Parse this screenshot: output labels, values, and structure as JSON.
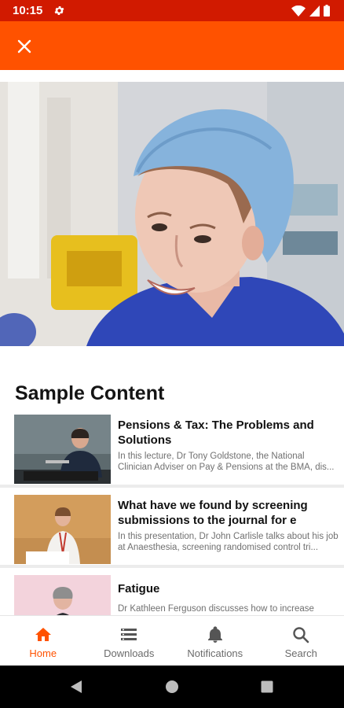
{
  "status_bar": {
    "time": "10:15",
    "icons": [
      "gear-icon",
      "wifi-icon",
      "signal-icon",
      "battery-icon"
    ]
  },
  "app_bar": {
    "background": "#ff5200",
    "close_icon": "close-icon"
  },
  "hero": {
    "image": "photo of smiling doctor in blue surgical cap and scrubs"
  },
  "section": {
    "title": "Sample Content"
  },
  "content_items": [
    {
      "title": "Pensions & Tax: The Problems and Solutions",
      "description": "In this lecture, Dr Tony Goldstone, the National Clinician Adviser on Pay & Pensions at the BMA, dis..."
    },
    {
      "title": "What have we found by screening submissions to the journal for e",
      "description": "In this presentation, Dr John Carlisle talks about his job at Anaesthesia, screening randomised control tri..."
    },
    {
      "title": "Fatigue",
      "description": "Dr Kathleen Ferguson discusses how to increase"
    }
  ],
  "bottom_nav": {
    "accent": "#ff5200",
    "items": [
      {
        "label": "Home",
        "icon": "home-icon",
        "active": true
      },
      {
        "label": "Downloads",
        "icon": "downloads-icon",
        "active": false
      },
      {
        "label": "Notifications",
        "icon": "bell-icon",
        "active": false
      },
      {
        "label": "Search",
        "icon": "search-icon",
        "active": false
      }
    ]
  },
  "system_nav": {
    "icons": [
      "back-icon",
      "home-circle-icon",
      "recents-icon"
    ]
  }
}
